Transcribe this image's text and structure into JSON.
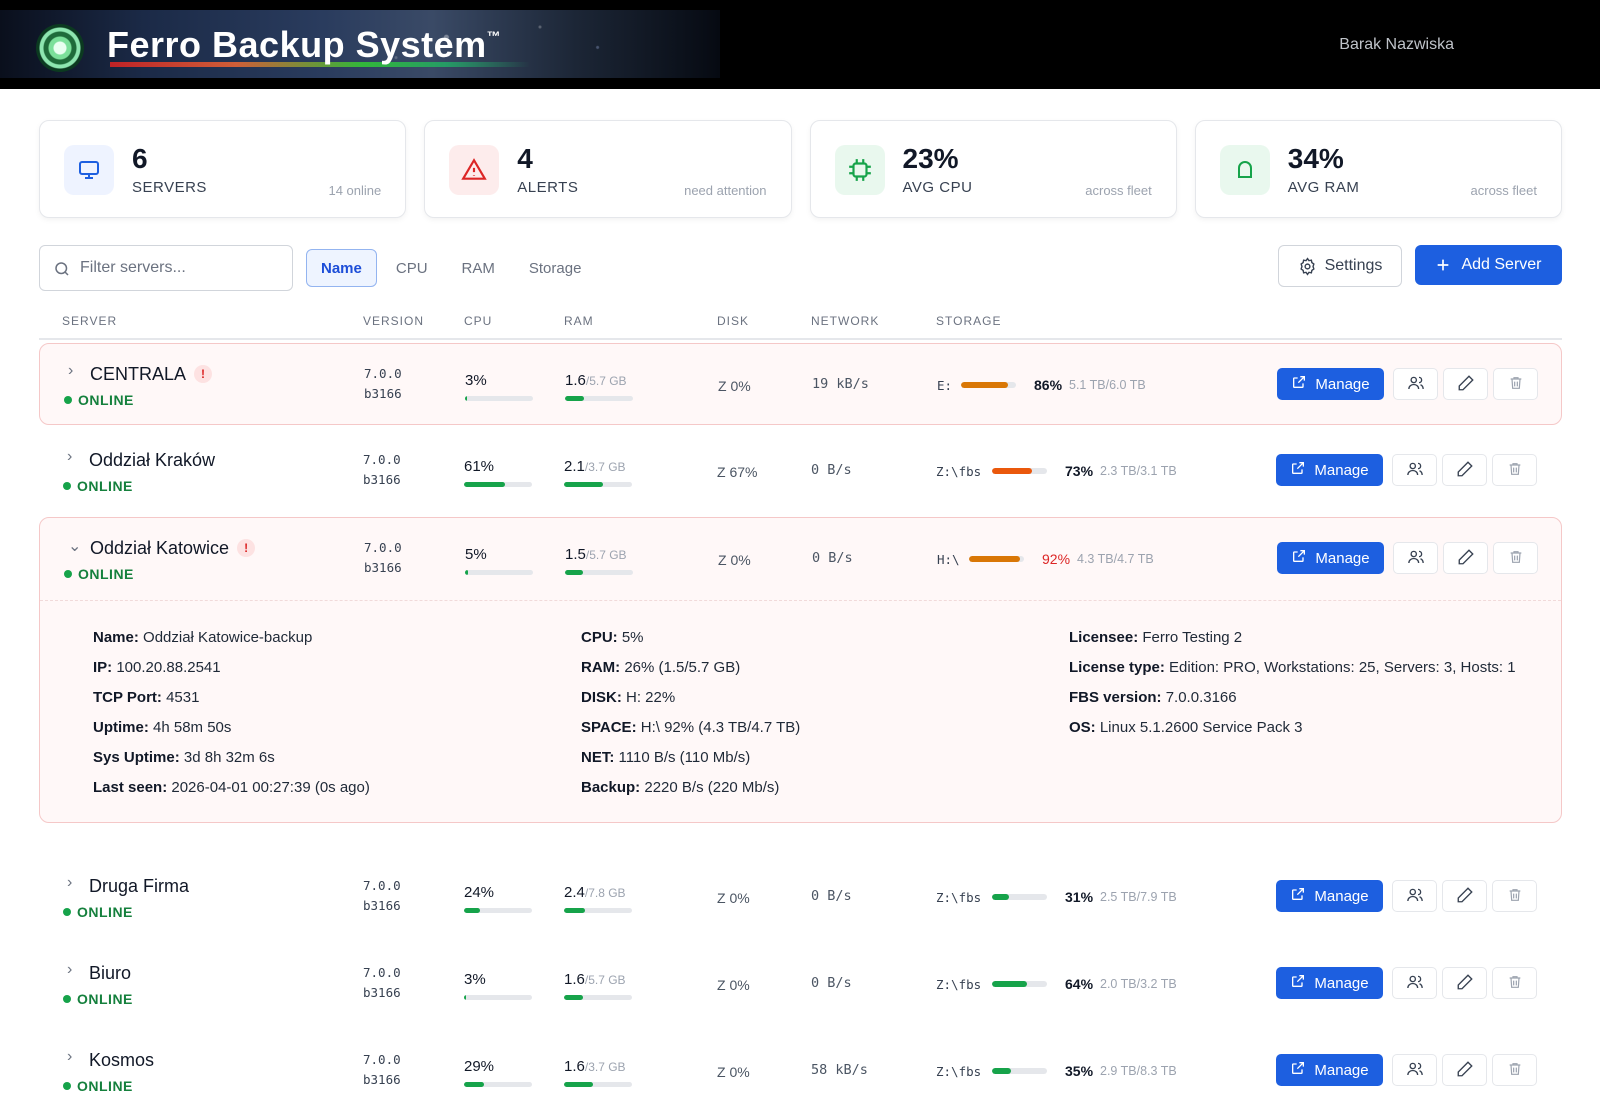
{
  "header": {
    "title": "Ferro Backup System",
    "trademark": "™",
    "user": "Barak Nazwiska"
  },
  "stats": [
    {
      "value": "6",
      "label": "SERVERS",
      "sub": "14 online",
      "icon": "monitor-icon"
    },
    {
      "value": "4",
      "label": "ALERTS",
      "sub": "need attention",
      "icon": "warning-icon"
    },
    {
      "value": "23%",
      "label": "AVG CPU",
      "sub": "across fleet",
      "icon": "cpu-icon"
    },
    {
      "value": "34%",
      "label": "AVG RAM",
      "sub": "across fleet",
      "icon": "memory-icon"
    }
  ],
  "toolbar": {
    "search_placeholder": "Filter servers...",
    "sort_tabs": [
      "Name",
      "CPU",
      "RAM",
      "Storage"
    ],
    "active_sort": "Name",
    "settings_label": "Settings",
    "add_label": "Add Server"
  },
  "columns": [
    "SERVER",
    "VERSION",
    "CPU",
    "RAM",
    "DISK",
    "NETWORK",
    "STORAGE"
  ],
  "rows": [
    {
      "name": "CENTRALA",
      "alert": true,
      "status": "ONLINE",
      "version": "7.0.0",
      "build": "b3166",
      "cpu": "3%",
      "cpu_pct": 3,
      "ram_used": "1.6",
      "ram_total": "/5.7 GB",
      "ram_pct": 28,
      "disk": "Z 0%",
      "net": "19 kB/s",
      "drive": "E:",
      "storage_pct_label": "86%",
      "storage_pct": 86,
      "storage_cap": "5.1 TB/6.0 TB",
      "storage_color": "#d97706"
    },
    {
      "name": "Oddział Kraków",
      "alert": false,
      "status": "ONLINE",
      "version": "7.0.0",
      "build": "b3166",
      "cpu": "61%",
      "cpu_pct": 61,
      "ram_used": "2.1",
      "ram_total": "/3.7 GB",
      "ram_pct": 57,
      "disk": "Z 67%",
      "net": "0 B/s",
      "drive": "Z:\\fbs",
      "storage_pct_label": "73%",
      "storage_pct": 73,
      "storage_cap": "2.3 TB/3.1 TB",
      "storage_color": "#ea580c"
    },
    {
      "name": "Oddział Katowice",
      "alert": true,
      "expanded": true,
      "status": "ONLINE",
      "version": "7.0.0",
      "build": "b3166",
      "cpu": "5%",
      "cpu_pct": 5,
      "ram_used": "1.5",
      "ram_total": "/5.7 GB",
      "ram_pct": 26,
      "disk": "Z 0%",
      "net": "0 B/s",
      "drive": "H:\\",
      "storage_pct_label": "92%",
      "storage_pct": 92,
      "storage_cap": "4.3 TB/4.7 TB",
      "storage_color": "#d97706"
    },
    {
      "name": "Druga Firma",
      "alert": false,
      "status": "ONLINE",
      "version": "7.0.0",
      "build": "b3166",
      "cpu": "24%",
      "cpu_pct": 24,
      "ram_used": "2.4",
      "ram_total": "/7.8 GB",
      "ram_pct": 31,
      "disk": "Z 0%",
      "net": "0 B/s",
      "drive": "Z:\\fbs",
      "storage_pct_label": "31%",
      "storage_pct": 31,
      "storage_cap": "2.5 TB/7.9 TB",
      "storage_color": "#16a34a"
    },
    {
      "name": "Biuro",
      "alert": false,
      "status": "ONLINE",
      "version": "7.0.0",
      "build": "b3166",
      "cpu": "3%",
      "cpu_pct": 3,
      "ram_used": "1.6",
      "ram_total": "/5.7 GB",
      "ram_pct": 28,
      "disk": "Z 0%",
      "net": "0 B/s",
      "drive": "Z:\\fbs",
      "storage_pct_label": "64%",
      "storage_pct": 64,
      "storage_cap": "2.0 TB/3.2 TB",
      "storage_color": "#16a34a"
    },
    {
      "name": "Kosmos",
      "alert": false,
      "status": "ONLINE",
      "version": "7.0.0",
      "build": "b3166",
      "cpu": "29%",
      "cpu_pct": 29,
      "ram_used": "1.6",
      "ram_total": "/3.7 GB",
      "ram_pct": 43,
      "disk": "Z 0%",
      "net": "58 kB/s",
      "drive": "Z:\\fbs",
      "storage_pct_label": "35%",
      "storage_pct": 35,
      "storage_cap": "2.9 TB/8.3 TB",
      "storage_color": "#16a34a"
    }
  ],
  "row_actions": {
    "manage_label": "Manage"
  },
  "details": {
    "col1": [
      {
        "k": "Name:",
        "v": "Oddział Katowice-backup"
      },
      {
        "k": "IP:",
        "v": "100.20.88.2541"
      },
      {
        "k": "TCP Port:",
        "v": "4531"
      },
      {
        "k": "Uptime:",
        "v": "4h 58m 50s"
      },
      {
        "k": "Sys Uptime:",
        "v": "3d 8h 32m 6s"
      },
      {
        "k": "Last seen:",
        "v": "2026-04-01 00:27:39 (0s ago)"
      }
    ],
    "col2": [
      {
        "k": "CPU:",
        "v": "5%"
      },
      {
        "k": "RAM:",
        "v": "26% (1.5/5.7 GB)"
      },
      {
        "k": "DISK:",
        "v": "H: 22%"
      },
      {
        "k": "SPACE:",
        "v": "H:\\ 92% (4.3 TB/4.7 TB)"
      },
      {
        "k": "NET:",
        "v": "1110 B/s (110 Mb/s)"
      },
      {
        "k": "Backup:",
        "v": "2220 B/s (220 Mb/s)"
      }
    ],
    "col3": [
      {
        "k": "Licensee:",
        "v": "Ferro Testing 2"
      },
      {
        "k": "License type:",
        "v": "Edition: PRO, Workstations: 25, Servers: 3, Hosts: 1"
      },
      {
        "k": "FBS version:",
        "v": "7.0.0.3166"
      },
      {
        "k": "OS:",
        "v": "Linux 5.1.2600 Service Pack 3"
      }
    ]
  },
  "colors": {
    "accent": "#1d5fe0",
    "online": "#16a34a",
    "alert": "#dc2626"
  }
}
